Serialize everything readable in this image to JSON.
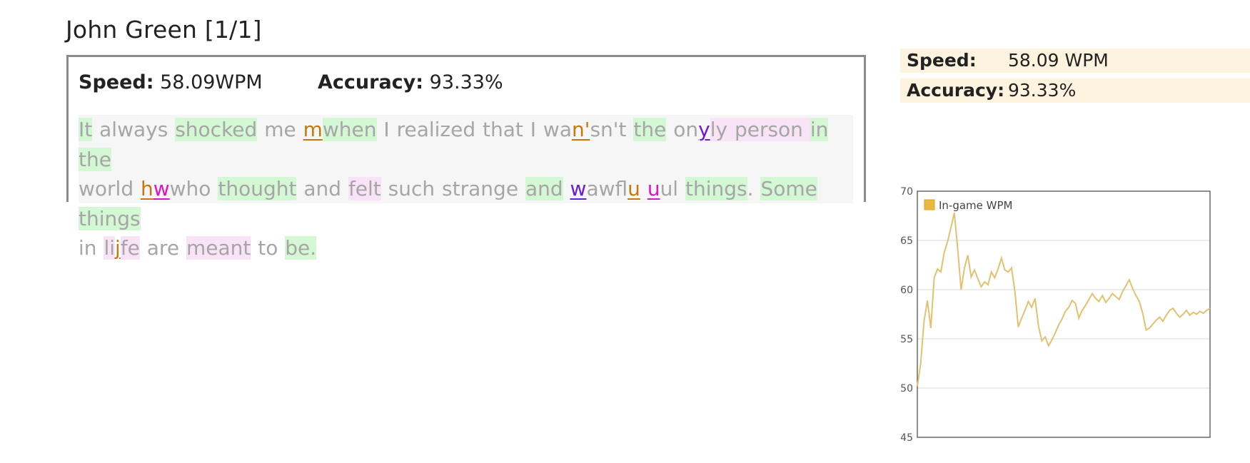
{
  "header": {
    "title": "John Green [1/1]"
  },
  "replay": {
    "speed_label": "Speed:",
    "speed_value": "58.09WPM",
    "accuracy_label": "Accuracy:",
    "accuracy_value": "93.33%",
    "lines": [
      [
        {
          "t": "It",
          "c": "g"
        },
        {
          "t": " always ",
          "c": ""
        },
        {
          "t": "shocked",
          "c": "g"
        },
        {
          "t": " me ",
          "c": ""
        },
        {
          "t": "m",
          "c": "eo"
        },
        {
          "t": "when",
          "c": "g"
        },
        {
          "t": " I realized that I wa",
          "c": ""
        },
        {
          "t": "n'",
          "c": "eo"
        },
        {
          "t": "sn't ",
          "c": ""
        },
        {
          "t": "the",
          "c": "g"
        },
        {
          "t": " on",
          "c": ""
        },
        {
          "t": "y",
          "c": "ev"
        },
        {
          "t": "ly person ",
          "c": "p"
        },
        {
          "t": "in",
          "c": "g"
        },
        {
          "t": " ",
          "c": ""
        },
        {
          "t": "the",
          "c": "g"
        }
      ],
      [
        {
          "t": "world ",
          "c": ""
        },
        {
          "t": "h",
          "c": "eo"
        },
        {
          "t": "w",
          "c": "em"
        },
        {
          "t": "who ",
          "c": ""
        },
        {
          "t": "thought",
          "c": "g"
        },
        {
          "t": " and ",
          "c": ""
        },
        {
          "t": "felt",
          "c": "p"
        },
        {
          "t": " such strange ",
          "c": ""
        },
        {
          "t": "and",
          "c": "g"
        },
        {
          "t": " ",
          "c": ""
        },
        {
          "t": "w",
          "c": "ev"
        },
        {
          "t": "awf",
          "c": ""
        },
        {
          "t": "lu",
          "c": "eo"
        },
        {
          "t": " ",
          "c": ""
        },
        {
          "t": "u",
          "c": "em"
        },
        {
          "t": "ul ",
          "c": ""
        },
        {
          "t": "things",
          "c": "g"
        },
        {
          "t": ". ",
          "c": ""
        },
        {
          "t": "Some",
          "c": "g"
        },
        {
          "t": " ",
          "c": ""
        },
        {
          "t": "things",
          "c": "g"
        }
      ],
      [
        {
          "t": "in ",
          "c": ""
        },
        {
          "t": "li",
          "c": "p"
        },
        {
          "t": "j",
          "c": "eo"
        },
        {
          "t": "fe",
          "c": "p"
        },
        {
          "t": " are ",
          "c": ""
        },
        {
          "t": "meant",
          "c": "p"
        },
        {
          "t": " to ",
          "c": ""
        },
        {
          "t": "be.",
          "c": "g"
        }
      ]
    ]
  },
  "side_stats": {
    "speed_label": "Speed:",
    "speed_value": "58.09 WPM",
    "accuracy_label": "Accuracy:",
    "accuracy_value": "93.33%"
  },
  "colors": {
    "correct_bg": "#d4f7d4",
    "pink_bg": "#f8e4f6",
    "error_orange": "#c9770c",
    "error_magenta": "#e013c4",
    "error_violet": "#6a1ad8",
    "series_line": "#e2c170",
    "legend_swatch": "#e8b93a",
    "stat_row_bg": "#fdf3de"
  },
  "chart_data": {
    "type": "line",
    "title": "",
    "xlabel": "",
    "ylabel": "",
    "ylim": [
      45,
      70
    ],
    "yticks": [
      45,
      50,
      55,
      60,
      65,
      70
    ],
    "grid": true,
    "legend_placement": "top-left",
    "series": [
      {
        "name": "In-game WPM",
        "values": [
          50.2,
          52.5,
          56.8,
          58.9,
          56.1,
          61.2,
          62.1,
          61.8,
          63.8,
          64.9,
          66.3,
          67.8,
          64.1,
          60.0,
          62.2,
          63.5,
          61.3,
          62.0,
          61.1,
          60.3,
          60.8,
          60.5,
          61.8,
          61.2,
          62.1,
          63.2,
          62.0,
          61.8,
          62.2,
          59.8,
          56.2,
          57.1,
          57.9,
          58.8,
          58.2,
          59.1,
          56.3,
          54.8,
          55.2,
          54.3,
          54.9,
          55.6,
          56.4,
          57.0,
          57.8,
          58.2,
          58.9,
          58.6,
          57.1,
          57.9,
          58.4,
          59.0,
          59.6,
          59.1,
          58.8,
          59.4,
          58.7,
          59.1,
          59.6,
          59.3,
          59.0,
          59.8,
          60.4,
          61.0,
          60.1,
          59.4,
          58.8,
          57.6,
          55.9,
          56.1,
          56.5,
          56.9,
          57.2,
          56.8,
          57.4,
          57.9,
          58.1,
          57.6,
          57.2,
          57.5,
          57.9,
          57.4,
          57.7,
          57.5,
          57.8,
          57.6,
          57.9,
          58.1
        ]
      }
    ]
  }
}
